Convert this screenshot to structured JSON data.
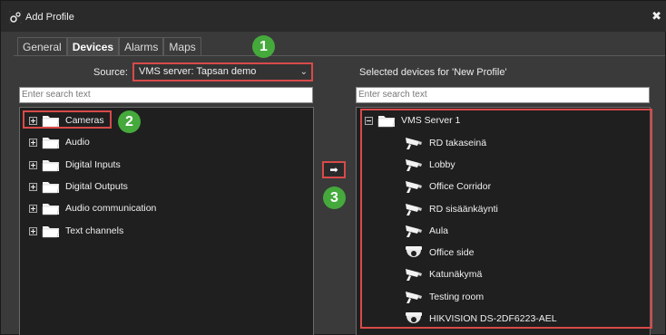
{
  "window": {
    "title": "Add Profile",
    "close_glyph": "✖"
  },
  "tabs": [
    {
      "label": "General",
      "active": false
    },
    {
      "label": "Devices",
      "active": true
    },
    {
      "label": "Alarms",
      "active": false
    },
    {
      "label": "Maps",
      "active": false
    }
  ],
  "source": {
    "label": "Source:",
    "value": "VMS server: Tapsan demo",
    "chevron": "⌄"
  },
  "left_search": {
    "placeholder": "Enter search text"
  },
  "right_title": "Selected devices for 'New Profile'",
  "right_search": {
    "placeholder": "Enter search text"
  },
  "left_tree": [
    {
      "label": "Cameras"
    },
    {
      "label": "Audio"
    },
    {
      "label": "Digital Inputs"
    },
    {
      "label": "Digital Outputs"
    },
    {
      "label": "Audio communication"
    },
    {
      "label": "Text channels"
    }
  ],
  "right_tree": {
    "root": "VMS Server 1",
    "devices": [
      {
        "label": "RD takaseinä",
        "icon": "bullet-camera-icon"
      },
      {
        "label": "Lobby",
        "icon": "bullet-camera-icon"
      },
      {
        "label": "Office Corridor",
        "icon": "bullet-camera-icon"
      },
      {
        "label": "RD sisäänkäynti",
        "icon": "bullet-camera-icon"
      },
      {
        "label": "Aula",
        "icon": "bullet-camera-icon"
      },
      {
        "label": "Office side",
        "icon": "dome-camera-icon"
      },
      {
        "label": "Katunäkymä",
        "icon": "bullet-camera-icon"
      },
      {
        "label": "Testing room",
        "icon": "bullet-camera-icon"
      },
      {
        "label": "HIKVISION DS-2DF6223-AEL",
        "icon": "dome-camera-icon"
      }
    ]
  },
  "add_button": {
    "glyph": "➡"
  },
  "badges": {
    "one": "1",
    "two": "2",
    "three": "3"
  },
  "colors": {
    "highlight": "#d84a4a",
    "badge": "#45a93c",
    "panel": "#1f1f1f"
  }
}
